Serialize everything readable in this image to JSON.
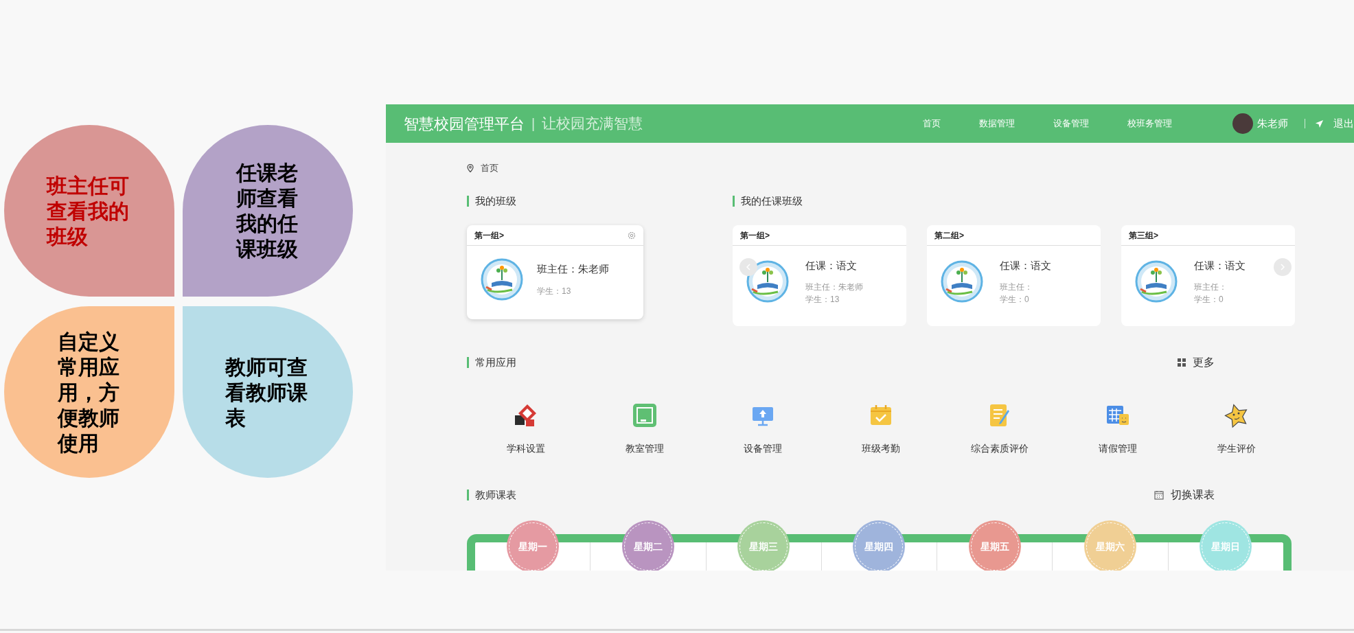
{
  "callouts": [
    {
      "text": "班主任可查看我的班级",
      "color": "#d99694",
      "emphasis": true
    },
    {
      "text": "任课老师查看我的任课班级",
      "color": "#b3a2c7",
      "emphasis": false
    },
    {
      "text": "自定义常用应用，方便教师使用",
      "color": "#fac090",
      "emphasis": false
    },
    {
      "text": "教师可查看教师课表",
      "color": "#b7dde8",
      "emphasis": false
    }
  ],
  "app": {
    "brand": "智慧校园管理平台",
    "separator": "|",
    "slogan": "让校园充满智慧",
    "nav": [
      "首页",
      "数据管理",
      "设备管理",
      "校班务管理"
    ],
    "user": "朱老师",
    "logout": "退出"
  },
  "breadcrumb": "首页",
  "my_class": {
    "title": "我的班级",
    "cards": [
      {
        "group": "第一组>",
        "teacher": "班主任：朱老师",
        "students": "学生：13"
      }
    ]
  },
  "teaching": {
    "title": "我的任课班级",
    "cards": [
      {
        "group": "第一组>",
        "subject": "任课：语文",
        "teacher": "班主任：朱老师",
        "students": "学生：13"
      },
      {
        "group": "第二组>",
        "subject": "任课：语文",
        "teacher": "班主任：",
        "students": "学生：0"
      },
      {
        "group": "第三组>",
        "subject": "任课：语文",
        "teacher": "班主任：",
        "students": "学生：0"
      }
    ]
  },
  "apps": {
    "title": "常用应用",
    "more": "更多",
    "items": [
      {
        "label": "学科设置",
        "kind": "subject"
      },
      {
        "label": "教室管理",
        "kind": "classroom"
      },
      {
        "label": "设备管理",
        "kind": "device"
      },
      {
        "label": "班级考勤",
        "kind": "attendance"
      },
      {
        "label": "综合素质评价",
        "kind": "evaluation"
      },
      {
        "label": "请假管理",
        "kind": "leave"
      },
      {
        "label": "学生评价",
        "kind": "student"
      }
    ]
  },
  "schedule": {
    "title": "教师课表",
    "switch": "切换课表",
    "days": [
      {
        "label": "星期一",
        "color": "#e59aa2"
      },
      {
        "label": "星期二",
        "color": "#b994c0"
      },
      {
        "label": "星期三",
        "color": "#a8d29c"
      },
      {
        "label": "星期四",
        "color": "#9fb4dc"
      },
      {
        "label": "星期五",
        "color": "#e89890"
      },
      {
        "label": "星期六",
        "color": "#f0cf94"
      },
      {
        "label": "星期日",
        "color": "#9fe5e2"
      }
    ]
  }
}
